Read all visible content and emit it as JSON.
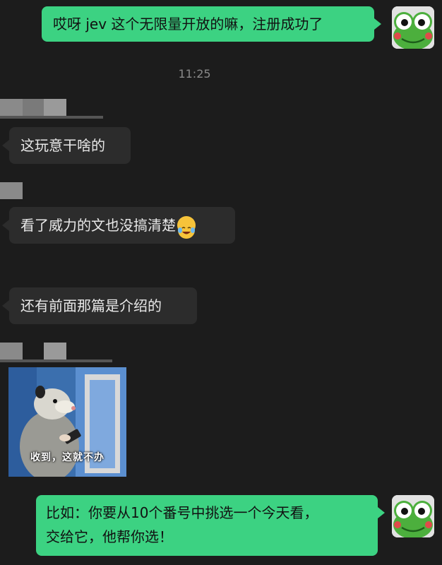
{
  "chat": {
    "timestamp": "11:25",
    "messages": [
      {
        "id": "m1",
        "side": "out",
        "text": "哎呀 jev 这个无限量开放的嘛，注册成功了"
      },
      {
        "id": "m2",
        "side": "in",
        "text": "这玩意干啥的"
      },
      {
        "id": "m3",
        "side": "in",
        "text": "看了威力的文也没搞清楚"
      },
      {
        "id": "m4",
        "side": "in",
        "text": "还有前面那篇是介绍的"
      },
      {
        "id": "m5",
        "side": "in",
        "type": "sticker",
        "caption": "收到，这就不办"
      },
      {
        "id": "m6",
        "side": "out",
        "line1": "比如：你要从10个番号中挑选一个今天看，",
        "line2": "交给它，他帮你选！"
      }
    ],
    "emoji_name": "face-with-tears-of-joy",
    "colors": {
      "outgoing": "#3cd282",
      "incoming": "#2c2c2c",
      "background": "#1c1c1c"
    }
  }
}
